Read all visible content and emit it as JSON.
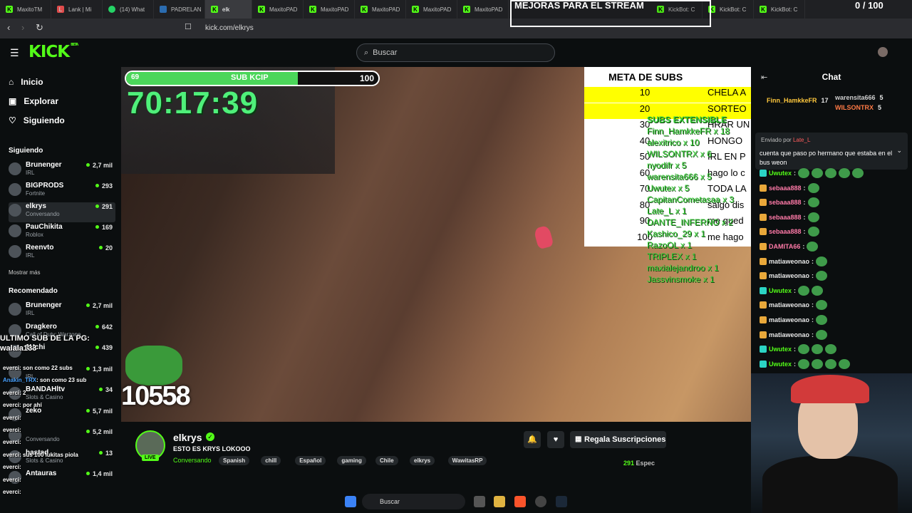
{
  "browser": {
    "tabs": [
      {
        "label": "MaxitoTM",
        "icon": "kick"
      },
      {
        "label": "Lank | Mi",
        "icon": "lank"
      },
      {
        "label": "(14) What",
        "icon": "whatsapp"
      },
      {
        "label": "PADRELAN",
        "icon": "padre"
      },
      {
        "label": "elk",
        "icon": "kick",
        "active": true
      },
      {
        "label": "MaxitoPAD",
        "icon": "kick"
      },
      {
        "label": "MaxitoPAD",
        "icon": "kick"
      },
      {
        "label": "MaxitoPAD",
        "icon": "kick"
      },
      {
        "label": "MaxitoPAD",
        "icon": "kick"
      },
      {
        "label": "MaxitoPAD",
        "icon": "kick"
      }
    ],
    "extra_tabs": [
      "KickBot: C",
      "KickBot: C",
      "KickBot: C"
    ],
    "url": "kick.com/elkrys"
  },
  "overlay": {
    "title": "MEJORAS PARA EL STREAM",
    "sub_counter": "0 / 100"
  },
  "header": {
    "logo": "KICK",
    "logo_tag": "BETA",
    "search_placeholder": "Buscar"
  },
  "sidebar": {
    "nav": [
      {
        "label": "Inicio",
        "icon": "home-icon"
      },
      {
        "label": "Explorar",
        "icon": "compass-icon"
      },
      {
        "label": "Siguiendo",
        "icon": "heart-icon"
      }
    ],
    "following_title": "Siguiendo",
    "following": [
      {
        "name": "Brunenger",
        "game": "IRL",
        "viewers": "2,7 mil"
      },
      {
        "name": "BIGPRODS",
        "game": "Fortnite",
        "viewers": "293"
      },
      {
        "name": "elkrys",
        "game": "Conversando",
        "viewers": "291",
        "selected": true
      },
      {
        "name": "PauChikita",
        "game": "Roblox",
        "viewers": "169"
      },
      {
        "name": "Reenvto",
        "game": "IRL",
        "viewers": "20"
      }
    ],
    "show_more": "Mostrar más",
    "recommended_title": "Recomendado",
    "recommended": [
      {
        "name": "Brunenger",
        "game": "IRL",
        "viewers": "2,7 mil"
      },
      {
        "name": "Dragkero",
        "game": "Call of Duty: Warzone",
        "viewers": "642"
      },
      {
        "name": "1Uchi",
        "game": "",
        "viewers": "439"
      },
      {
        "name": "",
        "game": "IRL",
        "viewers": "1,3 mil"
      },
      {
        "name": "BANDAHltv",
        "game": "Slots & Casino",
        "viewers": "34"
      },
      {
        "name": "zeko",
        "game": "",
        "viewers": "5,7 mil"
      },
      {
        "name": "",
        "game": "Conversando",
        "viewers": "5,2 mil"
      },
      {
        "name": "hastad",
        "game": "Slots & Casino",
        "viewers": "13"
      },
      {
        "name": "Antauras",
        "game": "",
        "viewers": "1,4 mil"
      }
    ]
  },
  "stream_overlay": {
    "bar_start": "69",
    "bar_label": "SUB KCIP",
    "bar_end": "100",
    "bar_progress": 0.68,
    "timer": "70:17:39",
    "points": "10558",
    "last_sub": "ULTIMO SUB DE LA PG: walala133",
    "subs_table": {
      "header": "META DE SUBS",
      "rows": [
        {
          "n": "10",
          "text": "CHELA A",
          "hl": true
        },
        {
          "n": "20",
          "text": "SORTEO",
          "hl": true
        },
        {
          "n": "30",
          "text": "HRAR UN"
        },
        {
          "n": "40",
          "text": "HONGO"
        },
        {
          "n": "50",
          "text": "IRL EN P"
        },
        {
          "n": "60",
          "text": "hago lo c"
        },
        {
          "n": "70",
          "text": "TODA LA"
        },
        {
          "n": "80",
          "text": "salgo dis"
        },
        {
          "n": "90",
          "text": "me qued"
        },
        {
          "n": "100",
          "text": "me hago"
        }
      ]
    },
    "subs_list_title": "SUBS EXTENSIBLE",
    "subs_list": [
      "Finn_HamkkeFR x 18",
      "alexitrico x 10",
      "WILSONTRX x 6",
      "nyodifr x 5",
      "warensita666 x 5",
      "Uwutex x 5",
      "CapitanCometasaa x 3",
      "Late_L x 1",
      "DANTE_INFERNO x 2",
      "Kashico_29 x 1",
      "RazoOL x 1",
      "TRIPLEX x 1",
      "maxialejandroo x 1",
      "Jassvinsmoke x 1"
    ]
  },
  "overlay_chat": [
    {
      "user": "everci",
      "text": "son como 22 subs"
    },
    {
      "user": "Anakin_TRX",
      "text": "son como 23 sub"
    },
    {
      "user": "everci",
      "text": "2"
    },
    {
      "user": "everci",
      "text": "por ahí"
    },
    {
      "user": "everci",
      "text": ""
    },
    {
      "user": "everci",
      "text": ""
    },
    {
      "user": "everci",
      "text": ""
    },
    {
      "user": "everci",
      "text": "sus 100 lukitas piola"
    },
    {
      "user": "everci",
      "text": ""
    },
    {
      "user": "everci",
      "text": ""
    },
    {
      "user": "everci",
      "text": ""
    }
  ],
  "chat": {
    "title": "Chat",
    "leaders": [
      {
        "name": "Finn_HamkkeFR",
        "count": "17",
        "color": "#ffc83d"
      },
      {
        "name": "warensita666",
        "count": "5",
        "color": "#cfcfcf"
      },
      {
        "name": "WILSONTRX",
        "count": "5",
        "color": "#ff7a45"
      }
    ],
    "pinned_by": "Enviado por",
    "pinned_user": "Late_L",
    "pinned_message": "cuenta que paso po hermano que estaba en el bus weon",
    "messages": [
      {
        "user": "Uwutex",
        "color": "#53fc18",
        "emotes": 5
      },
      {
        "user": "sebaaa888",
        "color": "#ff7aa8",
        "emotes": 1
      },
      {
        "user": "sebaaa888",
        "color": "#ff7aa8",
        "emotes": 1
      },
      {
        "user": "sebaaa888",
        "color": "#ff7aa8",
        "emotes": 1
      },
      {
        "user": "sebaaa888",
        "color": "#ff7aa8",
        "emotes": 1
      },
      {
        "user": "DAMITA66",
        "color": "#ff7aa8",
        "emotes": 1
      },
      {
        "user": "matiaweonao",
        "color": "#e6e6e6",
        "emotes": 1
      },
      {
        "user": "matiaweonao",
        "color": "#e6e6e6",
        "emotes": 1
      },
      {
        "user": "Uwutex",
        "color": "#53fc18",
        "emotes": 2
      },
      {
        "user": "matiaweonao",
        "color": "#e6e6e6",
        "emotes": 1
      },
      {
        "user": "matiaweonao",
        "color": "#e6e6e6",
        "emotes": 1
      },
      {
        "user": "matiaweonao",
        "color": "#e6e6e6",
        "emotes": 1
      },
      {
        "user": "Uwutex",
        "color": "#53fc18",
        "emotes": 3
      },
      {
        "user": "Uwutex",
        "color": "#53fc18",
        "emotes": 4
      }
    ]
  },
  "channel": {
    "name": "elkrys",
    "title": "ESTO ES KRYS LOKOOO",
    "category": "Conversando",
    "live": "LIVE",
    "tags": [
      "Spanish",
      "chill",
      "Español",
      "gaming",
      "Chile",
      "elkrys",
      "WawitasRP"
    ],
    "gift_label": "Regala Suscripciones",
    "viewers": "291",
    "viewers_suffix": "Espec"
  },
  "taskbar": {
    "search_placeholder": "Buscar"
  },
  "colors": {
    "brand": "#53fc18",
    "bg": "#0b0e0f"
  }
}
